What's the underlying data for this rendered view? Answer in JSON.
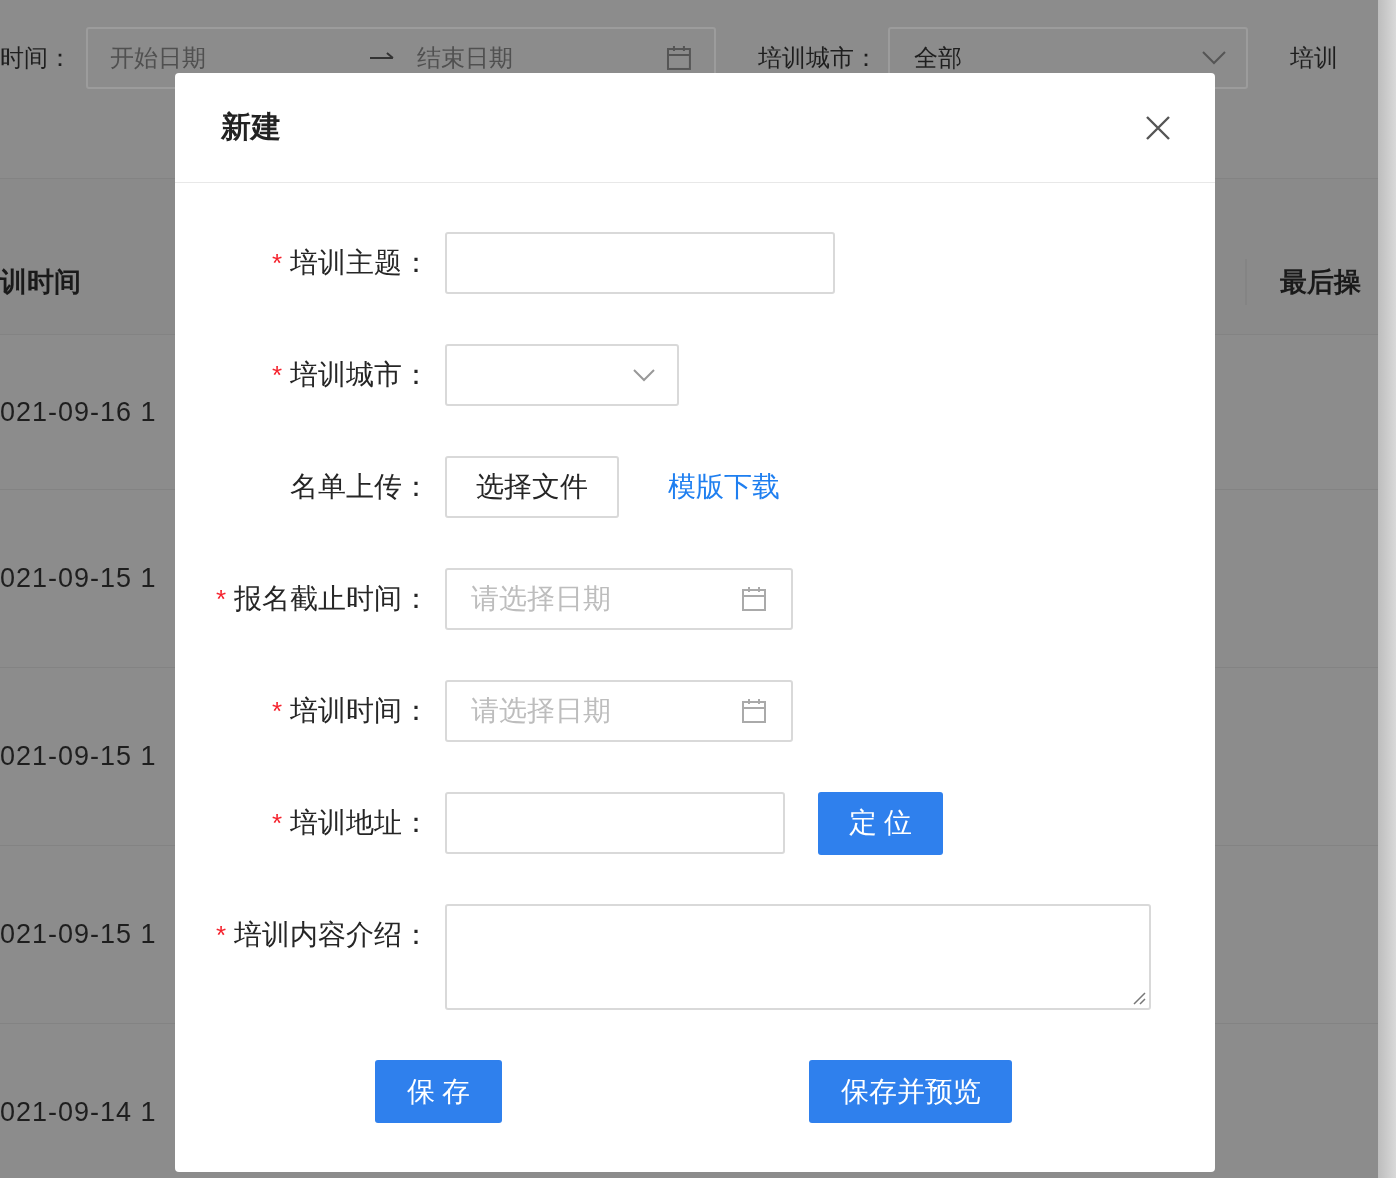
{
  "background": {
    "filters": [
      {
        "kind": "daterange",
        "label": "时间：",
        "start_placeholder": "开始日期",
        "end_placeholder": "结束日期"
      },
      {
        "kind": "select",
        "label": "培训城市：",
        "value": "全部"
      },
      {
        "kind": "label",
        "label": "培训"
      }
    ],
    "table": {
      "columns": [
        "训时间",
        "最后操"
      ],
      "rows": [
        "021-09-16 1",
        "021-09-15 1",
        "021-09-15 1",
        "021-09-15 1",
        "021-09-14 1"
      ]
    }
  },
  "dialog": {
    "title": "新建",
    "fields": [
      {
        "kind": "text",
        "label": "培训主题：",
        "required_mark": "*"
      },
      {
        "kind": "select",
        "label": "培训城市：",
        "required_mark": "*"
      },
      {
        "kind": "upload",
        "label": "名单上传：",
        "button": "选择文件",
        "link": "模版下载"
      },
      {
        "kind": "date",
        "label": "报名截止时间：",
        "required_mark": "*",
        "placeholder": "请选择日期"
      },
      {
        "kind": "date",
        "label": "培训时间：",
        "required_mark": "*",
        "placeholder": "请选择日期"
      },
      {
        "kind": "address",
        "label": "培训地址：",
        "required_mark": "*",
        "button": "定 位"
      },
      {
        "kind": "textarea",
        "label": "培训内容介绍：",
        "required_mark": "*"
      }
    ],
    "buttons": [
      "保 存",
      "保存并预览"
    ]
  }
}
